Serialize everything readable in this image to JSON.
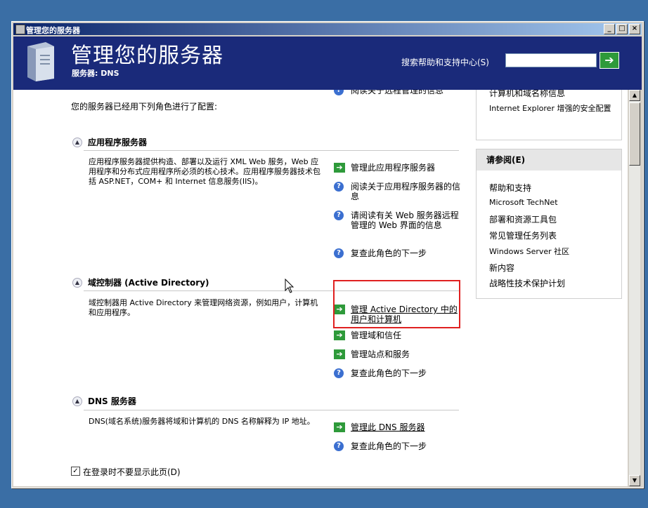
{
  "window": {
    "title": "管理您的服务器"
  },
  "header": {
    "title": "管理您的服务器",
    "server_label": "服务器: DNS",
    "search_label": "搜索帮助和支持中心(S)",
    "search_value": "",
    "go_arrow": "➔"
  },
  "main": {
    "intro": "您的服务器已经用下列角色进行了配置:",
    "top_partial_link": "阅读关于远程管理的信息",
    "roles": [
      {
        "title": "应用程序服务器",
        "description": "应用程序服务器提供构造、部署以及运行 XML Web 服务，Web 应用程序和分布式应用程序所必须的核心技术。应用程序服务器技术包括 ASP.NET，COM+ 和 Internet 信息服务(IIS)。",
        "actions": [
          "管理此应用程序服务器",
          "阅读关于应用程序服务器的信息",
          "请阅读有关 Web 服务器远程管理的 Web 界面的信息",
          "复查此角色的下一步"
        ]
      },
      {
        "title": "域控制器 (Active Directory)",
        "description": "域控制器用 Active Directory 来管理网络资源，例如用户，计算机和应用程序。",
        "actions": [
          "管理 Active Directory 中的用户和计算机",
          "管理域和信任",
          "管理站点和服务",
          "复查此角色的下一步"
        ]
      },
      {
        "title": "DNS 服务器",
        "description": "DNS(域名系统)服务器将域和计算机的 DNS 名称解释为 IP 地址。",
        "actions": [
          "管理此 DNS 服务器",
          "复查此角色的下一步"
        ]
      }
    ],
    "checkbox_label": "在登录时不要显示此页(D)",
    "checkbox_checked": true
  },
  "sidebar": {
    "top_links": [
      "计算机和域名称信息",
      "Internet Explorer 增强的安全配置"
    ],
    "see_also_title": "请参阅(E)",
    "see_also_links": [
      "帮助和支持",
      "Microsoft TechNet",
      "部署和资源工具包",
      "常见管理任务列表",
      "Windows Server 社区",
      "新内容",
      "战略性技术保护计划"
    ]
  }
}
